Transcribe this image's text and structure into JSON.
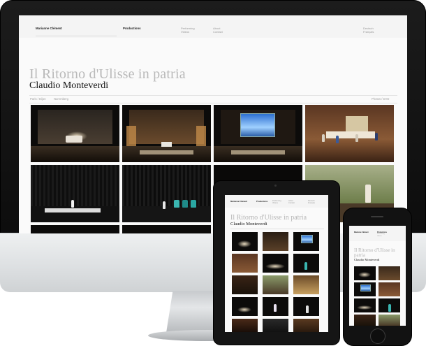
{
  "site": {
    "nav_name": "Marianne Clément",
    "nav_productions": "Productions",
    "nav_performing": "Performing",
    "nav_videos": "Videos",
    "nav_about": "About",
    "nav_contact": "Contact",
    "lang_de": "Deutsch",
    "lang_fr": "Français",
    "title": "Il Ritorno d'Ulisse in patria",
    "subtitle": "Claudio Monteverdi",
    "filter_left": "Paris / Dijon",
    "filter_mid": "Nuremberg",
    "filter_right": "Photos / DVD"
  },
  "tablet": {
    "nav_name": "Marianne Clément",
    "nav_productions": "Productions",
    "nav_performing": "Performing",
    "nav_videos": "Videos",
    "nav_about": "About",
    "nav_contact": "Contact",
    "lang_de": "Deutsch",
    "lang_fr": "Français",
    "title": "Il Ritorno d'Ulisse in patria",
    "subtitle": "Claudio Monteverdi"
  },
  "phone": {
    "nav_name": "Marianne Clément",
    "nav_productions": "Productions",
    "nav_performing": "Performing",
    "nav_videos": "Videos",
    "title": "Il Ritorno d'Ulisse in patria",
    "subtitle": "Claudio Monteverdi"
  }
}
